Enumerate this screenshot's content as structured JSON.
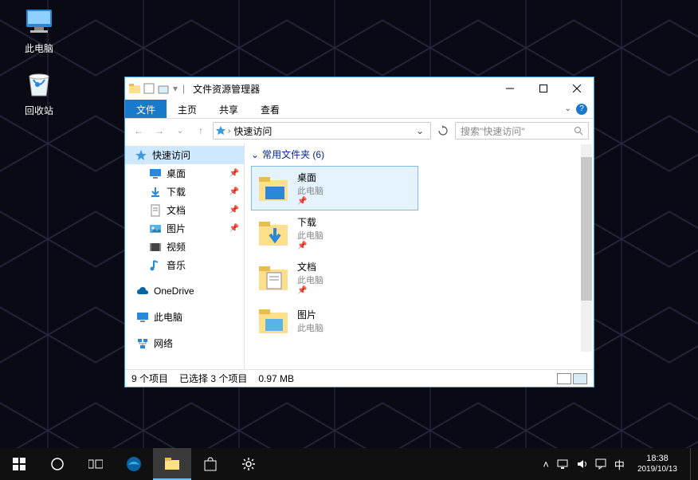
{
  "desktop_icons": {
    "this_pc": "此电脑",
    "recycle_bin": "回收站"
  },
  "window": {
    "title": "文件资源管理器",
    "tabs": {
      "file": "文件",
      "home": "主页",
      "share": "共享",
      "view": "查看"
    },
    "address": "快速访问",
    "search_placeholder": "搜索\"快速访问\"",
    "group_header": "常用文件夹 (6)"
  },
  "nav": {
    "quick_access": "快速访问",
    "desktop": "桌面",
    "downloads": "下载",
    "documents": "文档",
    "pictures": "图片",
    "videos": "视频",
    "music": "音乐",
    "onedrive": "OneDrive",
    "this_pc": "此电脑",
    "network": "网络"
  },
  "items": [
    {
      "title": "桌面",
      "subtitle": "此电脑"
    },
    {
      "title": "下载",
      "subtitle": "此电脑"
    },
    {
      "title": "文档",
      "subtitle": "此电脑"
    },
    {
      "title": "图片",
      "subtitle": "此电脑"
    }
  ],
  "status": {
    "count": "9 个项目",
    "selected": "已选择 3 个项目",
    "size": "0.97 MB"
  },
  "tray": {
    "ime": "中",
    "time": "18:38",
    "date": "2019/10/13"
  }
}
